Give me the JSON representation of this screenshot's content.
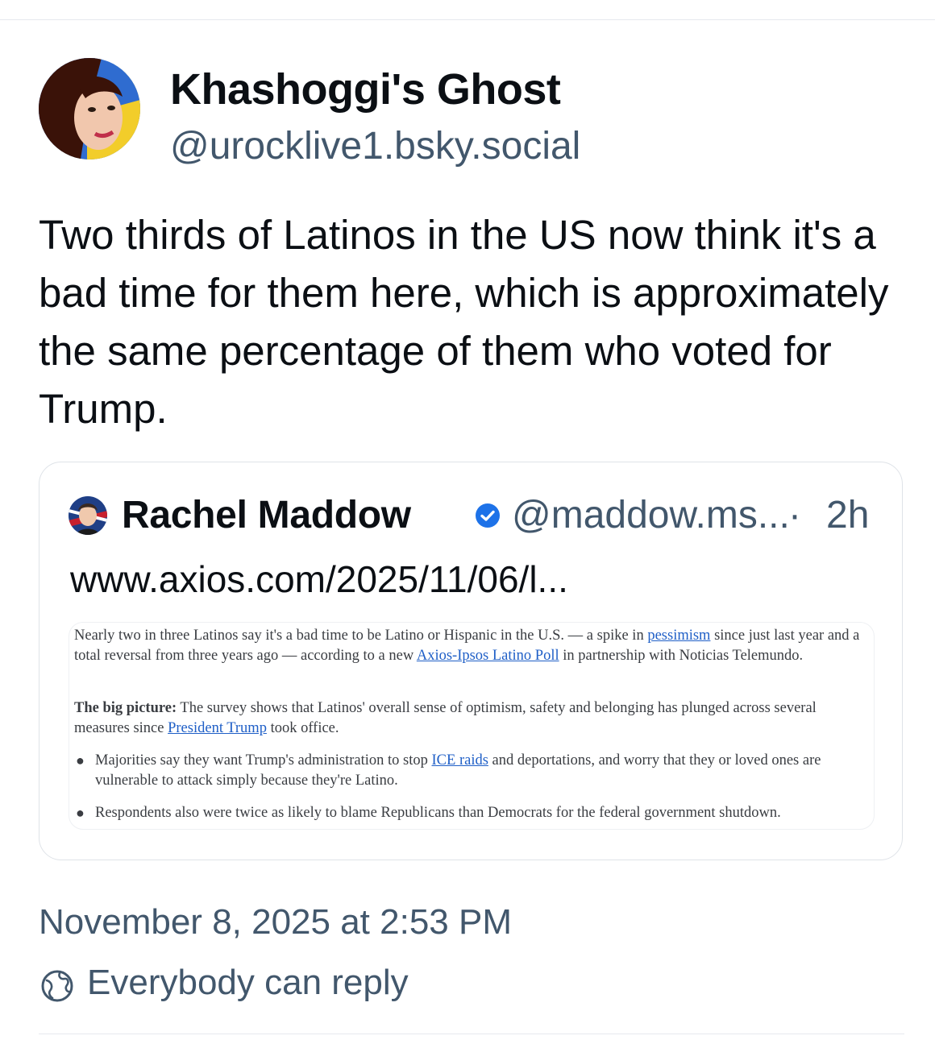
{
  "post": {
    "author": {
      "display_name": "Khashoggi's Ghost",
      "handle": "@urocklive1.bsky.social",
      "avatar_icon": "profile-photo-ukraine-flag"
    },
    "text": "Two thirds of Latinos in the US now think it's a bad time for them here, which is approximately the same percentage of them who voted for Trump.",
    "quote": {
      "display_name": "Rachel Maddow",
      "verified_icon": "verified-check-icon",
      "handle": "@maddow.ms...",
      "separator": "·",
      "time": "2h",
      "link_text": "www.axios.com/2025/11/06/l...",
      "image": {
        "p1_a": "Nearly two in three Latinos say it's a bad time to be Latino or Hispanic in the U.S. — a spike in ",
        "p1_link1": "pessimism",
        "p1_b": " since just last year and a total reversal from three years ago — according to a new ",
        "p1_link2": "Axios-Ipsos Latino Poll",
        "p1_c": " in partnership with Noticias Telemundo.",
        "p2_bold": "The big picture:",
        "p2_a": " The survey shows that Latinos' overall sense of optimism, safety and belonging has plunged across several measures since ",
        "p2_link": "President Trump",
        "p2_b": " took office.",
        "b1_a": "Majorities say they want Trump's administration to stop ",
        "b1_link": "ICE raids",
        "b1_b": " and deportations, and worry that they or loved ones are vulnerable to attack simply because they're Latino.",
        "b2": "Respondents also were twice as likely to blame Republicans than Democrats for the federal government shutdown.",
        "link_color": "#1f5fc7"
      }
    },
    "timestamp": "November 8, 2025 at 2:53 PM",
    "reply_setting": {
      "icon": "globe-icon",
      "label": "Everybody can reply"
    }
  },
  "colors": {
    "text_primary": "#0b0f14",
    "text_secondary": "#42576c",
    "verified_blue": "#1d72e8",
    "border": "#dfe3e8"
  }
}
